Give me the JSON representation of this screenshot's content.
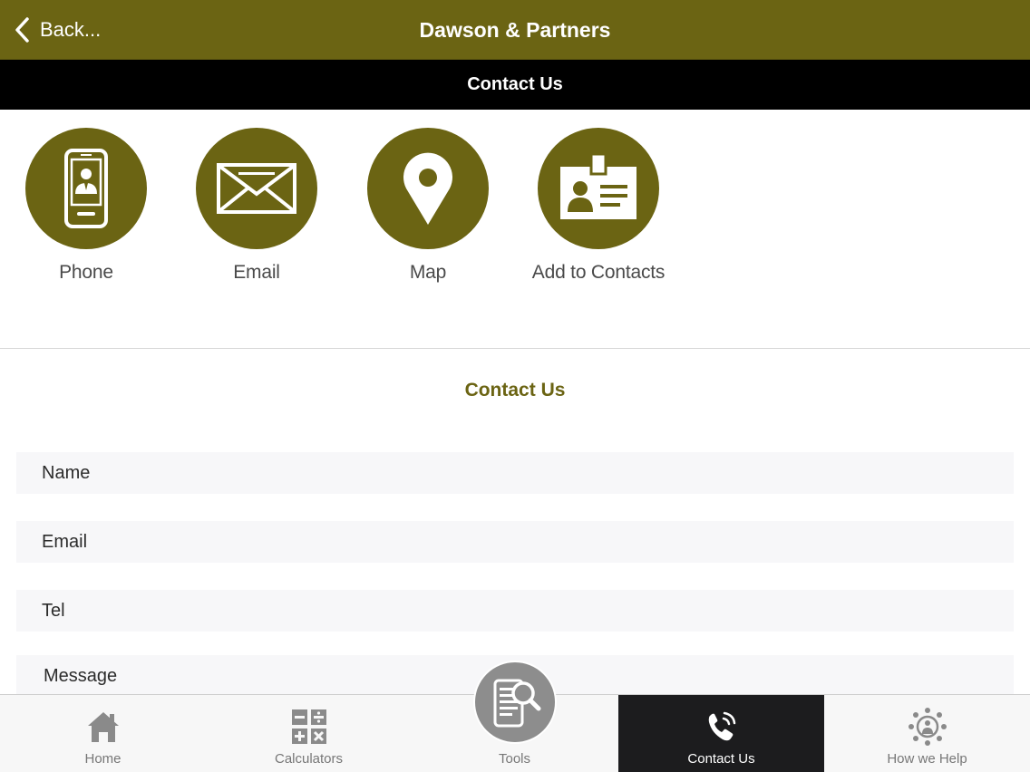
{
  "header": {
    "back_label": "Back...",
    "title": "Dawson & Partners"
  },
  "subheader": {
    "title": "Contact Us"
  },
  "actions": [
    {
      "label": "Phone",
      "icon": "phone-contact-icon"
    },
    {
      "label": "Email",
      "icon": "envelope-icon"
    },
    {
      "label": "Map",
      "icon": "map-pin-icon"
    },
    {
      "label": "Add to Contacts",
      "icon": "id-card-icon"
    }
  ],
  "form": {
    "title": "Contact Us",
    "fields": [
      {
        "placeholder": "Name",
        "value": ""
      },
      {
        "placeholder": "Email",
        "value": ""
      },
      {
        "placeholder": "Tel",
        "value": ""
      },
      {
        "placeholder": "Message",
        "value": ""
      }
    ]
  },
  "tabs": [
    {
      "label": "Home",
      "icon": "home-icon",
      "active": false
    },
    {
      "label": "Calculators",
      "icon": "calculator-icon",
      "active": false
    },
    {
      "label": "Tools",
      "icon": "tools-search-icon",
      "active": false
    },
    {
      "label": "Contact Us",
      "icon": "phone-call-icon",
      "active": true
    },
    {
      "label": "How we Help",
      "icon": "network-people-icon",
      "active": false
    }
  ],
  "colors": {
    "brand": "#6b6413",
    "subheader": "#000000",
    "active_tab": "#1c1c1e",
    "tab_icon": "#8a8a8a"
  }
}
